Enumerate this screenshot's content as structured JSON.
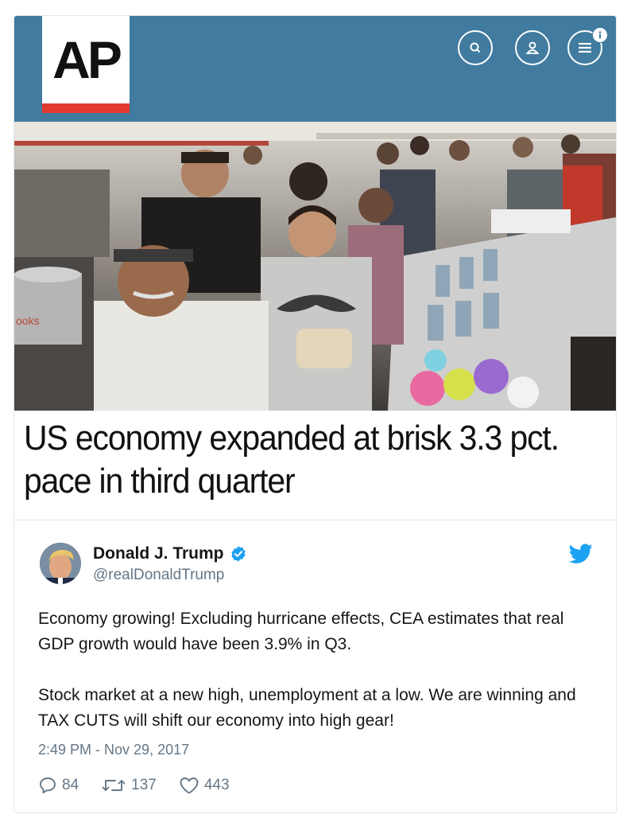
{
  "media": {
    "brand": "AP",
    "headline": "US economy expanded at brisk 3.3 pct. pace in third quarter",
    "photo_sign_text": "ooks",
    "colors": {
      "brand_bar": "#417b9f",
      "logo_stripe": "#e23b32"
    },
    "header_icons": [
      "search-icon",
      "user-icon",
      "menu-icon"
    ]
  },
  "tweet": {
    "author_name": "Donald J. Trump",
    "handle": "@realDonaldTrump",
    "verified": true,
    "text": "Economy growing! Excluding hurricane effects, CEA estimates that real GDP growth would have been 3.9% in Q3.\n\nStock market at a new high, unemployment at a low. We are winning and TAX CUTS will shift our economy into high gear!",
    "timestamp": "2:49 PM - Nov 29, 2017",
    "replies": "84",
    "retweets": "137",
    "likes": "443",
    "icons": [
      "verified-icon",
      "twitter-bird-icon",
      "reply-icon",
      "retweet-icon",
      "like-icon"
    ],
    "colors": {
      "accent": "#1da1f2",
      "muted": "#657786",
      "border": "#e1e8ed"
    }
  }
}
